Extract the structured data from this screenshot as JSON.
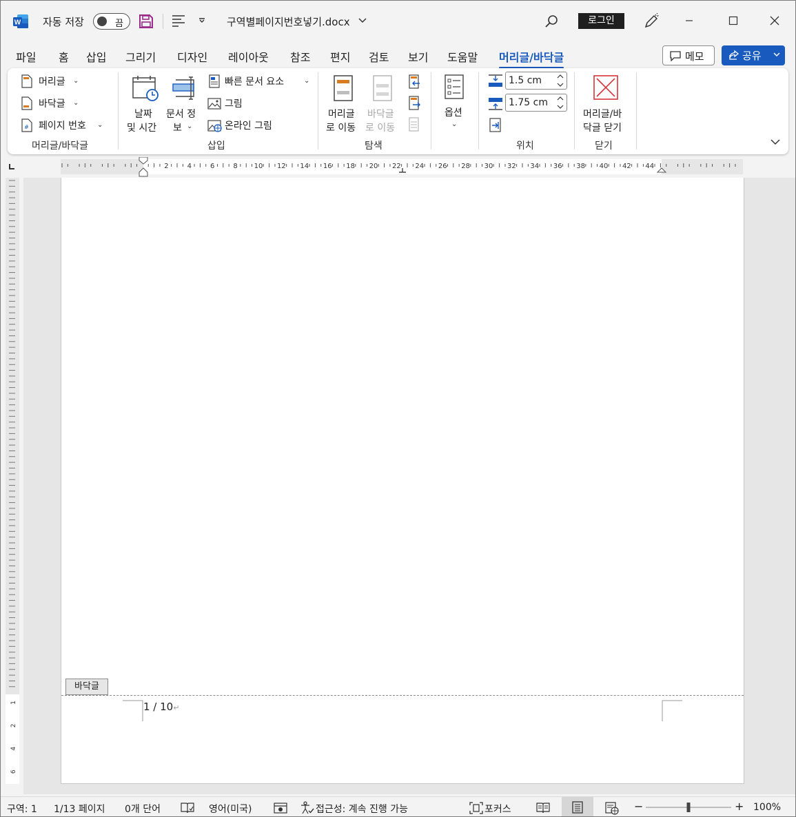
{
  "titlebar": {
    "autosave_label": "자동 저장",
    "autosave_state": "끔",
    "doc_title": "구역별페이지번호넣기.docx",
    "login_label": "로그인"
  },
  "tabs": [
    {
      "label": "파일"
    },
    {
      "label": "홈"
    },
    {
      "label": "삽입"
    },
    {
      "label": "그리기"
    },
    {
      "label": "디자인"
    },
    {
      "label": "레이아웃"
    },
    {
      "label": "참조"
    },
    {
      "label": "편지"
    },
    {
      "label": "검토"
    },
    {
      "label": "보기"
    },
    {
      "label": "도움말"
    },
    {
      "label": "머리글/바닥글"
    }
  ],
  "actions": {
    "memo_label": "메모",
    "share_label": "공유"
  },
  "ribbon": {
    "group_headerfooter": {
      "label": "머리글/바닥글",
      "header": "머리글",
      "footer": "바닥글",
      "page_number": "페이지 번호"
    },
    "group_insert": {
      "label": "삽입",
      "date_time_1": "날짜",
      "date_time_2": "및 시간",
      "doc_info_1": "문서 정",
      "doc_info_2": "보",
      "quick_parts": "빠른 문서 요소",
      "picture": "그림",
      "online_picture": "온라인 그림"
    },
    "group_navigate": {
      "label": "탐색",
      "goto_header_1": "머리글",
      "goto_header_2": "로 이동",
      "goto_footer_1": "바닥글",
      "goto_footer_2": "로 이동"
    },
    "group_options": {
      "label": "옵션"
    },
    "group_position": {
      "label": "위치",
      "header_from_top": "1.5 cm",
      "footer_from_bottom": "1.75 cm"
    },
    "group_close": {
      "label": "닫기",
      "close_1": "머리글/바",
      "close_2": "닥글 닫기"
    }
  },
  "ruler": {
    "h_ticks": [
      "2",
      "4",
      "6",
      "8",
      "10",
      "12",
      "14",
      "16",
      "18",
      "20",
      "22",
      "24",
      "26",
      "28",
      "30",
      "32",
      "34",
      "36",
      "38",
      "40",
      "42",
      "44"
    ],
    "v_ticks": [
      "1",
      "2",
      "4",
      "6"
    ]
  },
  "document": {
    "footer_tag": "바닥글",
    "footer_text": "1 / 10"
  },
  "statusbar": {
    "section": "구역: 1",
    "page": "1/13 페이지",
    "words": "0개 단어",
    "language": "영어(미국)",
    "accessibility": "접근성: 계속 진행 가능",
    "focus": "포커스",
    "zoom": "100%",
    "zoom_level": 1.0
  },
  "colors": {
    "accent": "#185abd",
    "word_brand": "#185abd",
    "close_red": "#d13438",
    "save_purple": "#9c2a8a"
  }
}
